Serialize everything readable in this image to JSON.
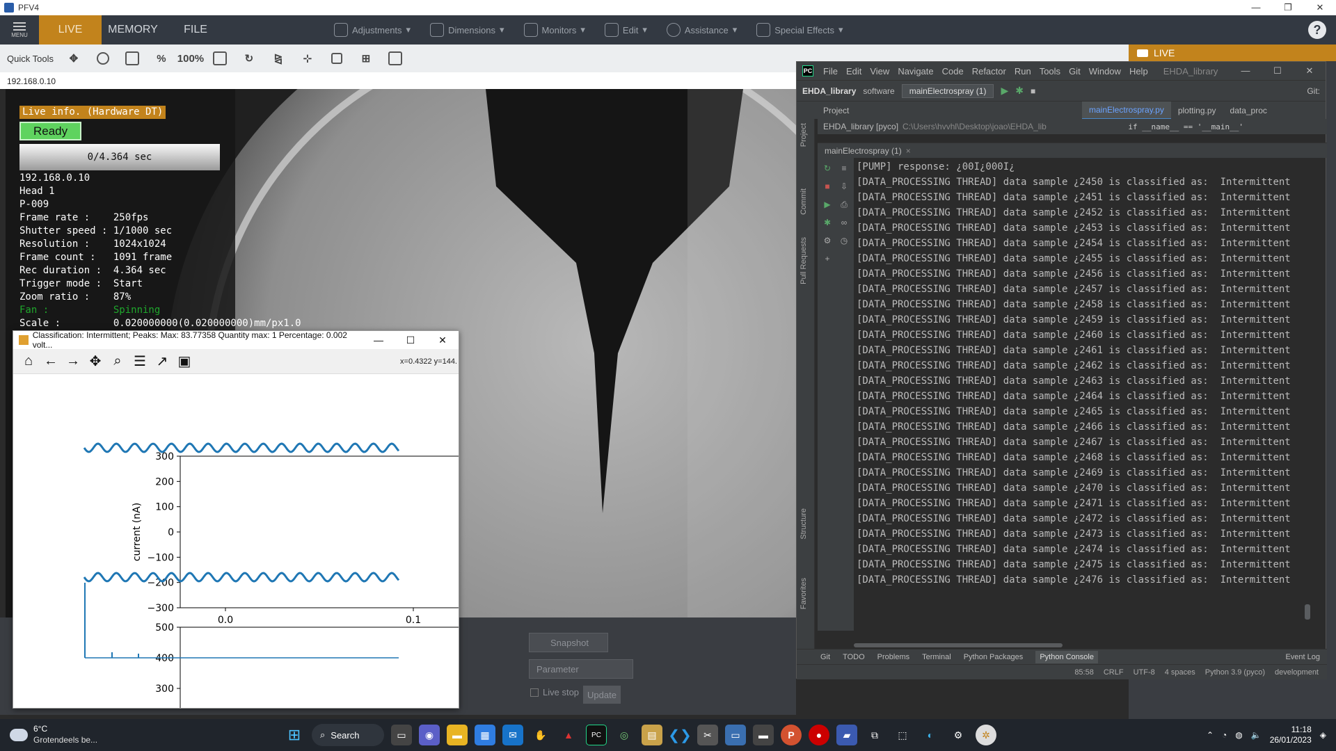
{
  "pfv": {
    "title": "PFV4",
    "menu_label": "MENU",
    "tabs": [
      "LIVE",
      "MEMORY",
      "FILE"
    ],
    "menus": [
      "Adjustments",
      "Dimensions",
      "Monitors",
      "Edit",
      "Assistance",
      "Special Effects"
    ],
    "quick_tools_label": "Quick Tools",
    "quick_tools": [
      "move",
      "zoom-in",
      "zoom-region",
      "%",
      "100%",
      "fit",
      "rotate",
      "flip",
      "grid-x",
      "lock",
      "split-4",
      "split-2"
    ],
    "ip": "192.168.0.10",
    "live_label": "LIVE",
    "snapshot_label": "Snapshot",
    "parameter_label": "Parameter",
    "live_stop_label": "Live stop",
    "update_label": "Update"
  },
  "live_info": {
    "header": "Live info. (Hardware DT)",
    "status": "Ready",
    "progress": "0/4.364 sec",
    "rows": [
      "192.168.0.10",
      "Head 1",
      "P-009",
      "Frame rate :    250fps",
      "Shutter speed : 1/1000 sec",
      "Resolution :    1024x1024",
      "Frame count :   1091 frame",
      "Rec duration :  4.364 sec",
      "Trigger mode :  Start",
      "Zoom ratio :    87%"
    ],
    "fan_row": "Fan :           Spinning",
    "scale_row": "Scale :         0.020000000(0.020000000)mm/px1.0"
  },
  "mpl": {
    "title": "Classification: Intermittent; Peaks: Max: 83.77358 Quantity max: 1 Percentage: 0.002 volt...",
    "coords": "x=0.4322 y=144.",
    "tools": [
      "home-icon",
      "back-icon",
      "forward-icon",
      "pan-icon",
      "zoom-icon",
      "configure-icon",
      "edit-curve-icon",
      "save-icon"
    ]
  },
  "chart_data": [
    {
      "type": "line",
      "ylabel": "current (nA)",
      "xlabel": "",
      "yticks": [
        "300",
        "200",
        "100",
        "0",
        "−100",
        "−200",
        "−300"
      ],
      "xticks": [
        "0.0",
        "0.1"
      ],
      "ylim": [
        -300,
        300
      ],
      "series": [
        {
          "values_note": "",
          "center": 330,
          "amplitude": 12
        },
        {
          "values_note": "",
          "center": -160,
          "amplitude": 12
        }
      ]
    },
    {
      "type": "line",
      "yticks": [
        "500",
        "400",
        "300"
      ],
      "ylim": [
        300,
        500
      ],
      "series": [
        {
          "baseline": 400,
          "spike": 500
        }
      ]
    }
  ],
  "pycharm": {
    "menus": [
      "File",
      "Edit",
      "View",
      "Navigate",
      "Code",
      "Refactor",
      "Run",
      "Tools",
      "Git",
      "Window",
      "Help"
    ],
    "project_name": "EHDA_library",
    "nav": [
      "EHDA_library",
      "software"
    ],
    "run_config": "mainElectrospray (1)",
    "git_label": "Git:",
    "tabs": [
      "mainElectrospray.py",
      "plotting.py",
      "data_proc"
    ],
    "project_label": "Project",
    "project_root": "EHDA_library [pyco]",
    "project_path": "C:\\Users\\hvvhl\\Desktop\\joao\\EHDA_lib",
    "code_line": "if __name__ == '__main__'",
    "run_tab": "mainElectrospray (1)",
    "side_labels": [
      "Project",
      "Commit",
      "Pull Requests",
      "Structure",
      "Favorites"
    ],
    "console_lines": [
      "[PUMP] response: ¿00I¿000I¿",
      "[DATA_PROCESSING THREAD] data sample ¿2450 is classified as:  Intermittent",
      "[DATA_PROCESSING THREAD] data sample ¿2451 is classified as:  Intermittent",
      "[DATA_PROCESSING THREAD] data sample ¿2452 is classified as:  Intermittent",
      "[DATA_PROCESSING THREAD] data sample ¿2453 is classified as:  Intermittent",
      "[DATA_PROCESSING THREAD] data sample ¿2454 is classified as:  Intermittent",
      "[DATA_PROCESSING THREAD] data sample ¿2455 is classified as:  Intermittent",
      "[DATA_PROCESSING THREAD] data sample ¿2456 is classified as:  Intermittent",
      "[DATA_PROCESSING THREAD] data sample ¿2457 is classified as:  Intermittent",
      "[DATA_PROCESSING THREAD] data sample ¿2458 is classified as:  Intermittent",
      "[DATA_PROCESSING THREAD] data sample ¿2459 is classified as:  Intermittent",
      "[DATA_PROCESSING THREAD] data sample ¿2460 is classified as:  Intermittent",
      "[DATA_PROCESSING THREAD] data sample ¿2461 is classified as:  Intermittent",
      "[DATA_PROCESSING THREAD] data sample ¿2462 is classified as:  Intermittent",
      "[DATA_PROCESSING THREAD] data sample ¿2463 is classified as:  Intermittent",
      "[DATA_PROCESSING THREAD] data sample ¿2464 is classified as:  Intermittent",
      "[DATA_PROCESSING THREAD] data sample ¿2465 is classified as:  Intermittent",
      "[DATA_PROCESSING THREAD] data sample ¿2466 is classified as:  Intermittent",
      "[DATA_PROCESSING THREAD] data sample ¿2467 is classified as:  Intermittent",
      "[DATA_PROCESSING THREAD] data sample ¿2468 is classified as:  Intermittent",
      "[DATA_PROCESSING THREAD] data sample ¿2469 is classified as:  Intermittent",
      "[DATA_PROCESSING THREAD] data sample ¿2470 is classified as:  Intermittent",
      "[DATA_PROCESSING THREAD] data sample ¿2471 is classified as:  Intermittent",
      "[DATA_PROCESSING THREAD] data sample ¿2472 is classified as:  Intermittent",
      "[DATA_PROCESSING THREAD] data sample ¿2473 is classified as:  Intermittent",
      "[DATA_PROCESSING THREAD] data sample ¿2474 is classified as:  Intermittent",
      "[DATA_PROCESSING THREAD] data sample ¿2475 is classified as:  Intermittent",
      "[DATA_PROCESSING THREAD] data sample ¿2476 is classified as:  Intermittent"
    ],
    "bottom_tabs": [
      "Git",
      "TODO",
      "Problems",
      "Terminal",
      "Python Packages",
      "Python Console"
    ],
    "event_log": "Event Log",
    "status": [
      "85:58",
      "CRLF",
      "UTF-8",
      "4 spaces",
      "Python 3.9 (pyco)",
      "development"
    ]
  },
  "taskbar": {
    "temp": "6°C",
    "weather": "Grotendeels be...",
    "search": "Search",
    "time": "11:18",
    "date": "26/01/2023"
  }
}
